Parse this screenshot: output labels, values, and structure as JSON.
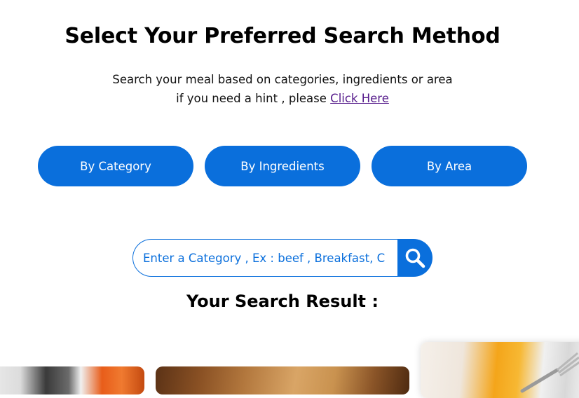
{
  "header": {
    "title": "Select Your Preferred Search Method",
    "subtitle_line1": "Search your meal based on categories, ingredients or area",
    "subtitle_line2": "if you need a hint , please",
    "hint_link": "Click Here"
  },
  "methods": [
    {
      "label": "By Category"
    },
    {
      "label": "By Ingredients"
    },
    {
      "label": "By Area"
    }
  ],
  "search": {
    "placeholder": "Enter a Category , Ex : beef , Breakfast, C",
    "button_icon": "search-icon"
  },
  "results": {
    "heading": "Your Search Result :"
  },
  "colors": {
    "accent": "#0a6fdc",
    "link": "#551a8b"
  }
}
